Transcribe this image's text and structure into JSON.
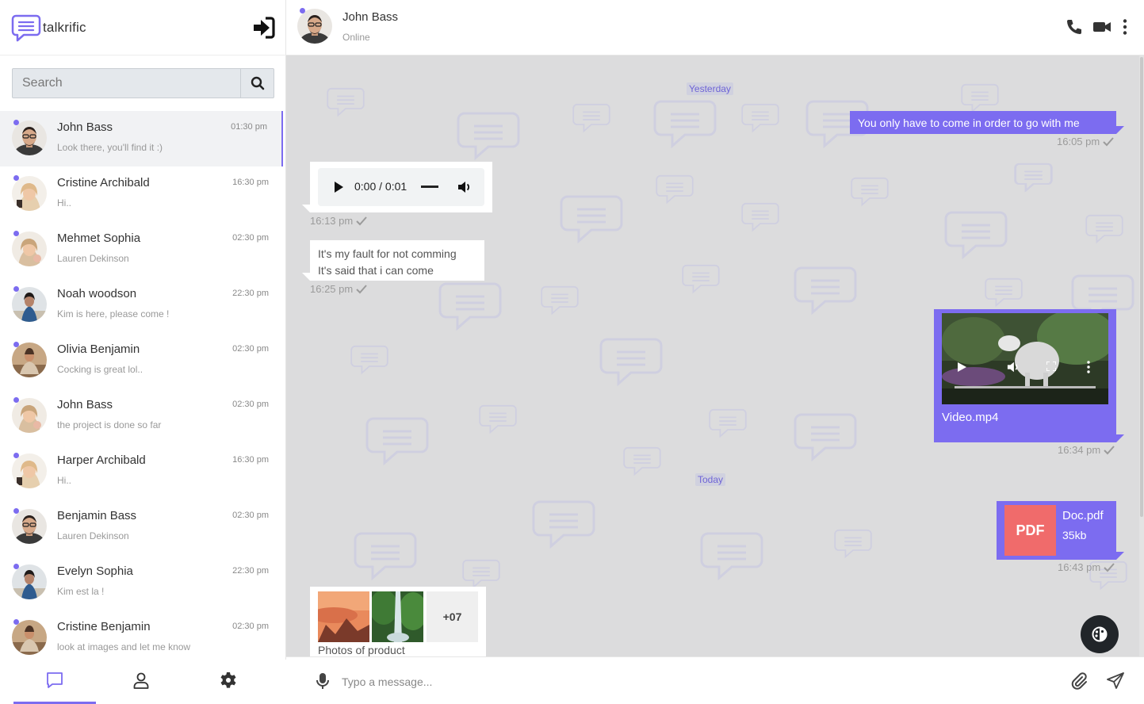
{
  "app": {
    "name": "talkrific"
  },
  "search": {
    "placeholder": "Search"
  },
  "contacts": [
    {
      "name": "John Bass",
      "preview": "Look there, you'll find it :)",
      "time": "01:30 pm",
      "avatar": "man-glasses"
    },
    {
      "name": "Cristine Archibald",
      "preview": "Hi..",
      "time": "16:30 pm",
      "avatar": "woman-blonde"
    },
    {
      "name": "Mehmet Sophia",
      "preview": "Lauren Dekinson",
      "time": "02:30 pm",
      "avatar": "woman-blonde"
    },
    {
      "name": "Noah woodson",
      "preview": "Kim is here, please come !",
      "time": "22:30 pm",
      "avatar": "woman-dark"
    },
    {
      "name": "Olivia Benjamin",
      "preview": "Cocking is great lol..",
      "time": "02:30 pm",
      "avatar": "man-sitting"
    },
    {
      "name": "John Bass",
      "preview": "the project is done so far",
      "time": "02:30 pm",
      "avatar": "woman-blonde"
    },
    {
      "name": "Harper Archibald",
      "preview": "Hi..",
      "time": "16:30 pm",
      "avatar": "woman-blonde"
    },
    {
      "name": "Benjamin Bass",
      "preview": "Lauren Dekinson",
      "time": "02:30 pm",
      "avatar": "man-glasses"
    },
    {
      "name": "Evelyn Sophia",
      "preview": "Kim est la !",
      "time": "22:30 pm",
      "avatar": "woman-dark"
    },
    {
      "name": "Cristine Benjamin",
      "preview": "look at images and let me know",
      "time": "02:30 pm",
      "avatar": "man-sitting"
    }
  ],
  "chat": {
    "name": "John Bass",
    "status": "Online",
    "day_labels": {
      "yesterday": "Yesterday",
      "today": "Today"
    },
    "messages": {
      "m1": {
        "text": "You only have to come in order to go with me",
        "time": "16:05 pm"
      },
      "audio": {
        "time_display": "0:00 / 0:01",
        "time": "16:13 pm"
      },
      "m3": {
        "line1": "It's my fault for not comming",
        "line2": "It's said that i can come",
        "time": "16:25 pm"
      },
      "video": {
        "filename": "Video.mp4",
        "time": "16:34 pm"
      },
      "pdf": {
        "badge": "PDF",
        "filename": "Doc.pdf",
        "size": "35kb",
        "time": "16:43 pm"
      },
      "photos": {
        "more": "+07",
        "caption": "Photos of product"
      }
    }
  },
  "composer": {
    "placeholder": "Typo a message..."
  },
  "colors": {
    "accent": "#7c6cf0",
    "pdf": "#f06b6b",
    "chat_bg": "#dcdcdd"
  },
  "icons": [
    "chat-bubble-icon",
    "logout-icon",
    "search-icon",
    "phone-icon",
    "video-camera-icon",
    "more-vertical-icon",
    "play-icon",
    "volume-icon",
    "fullscreen-icon",
    "check-icon",
    "theme-icon",
    "microphone-icon",
    "paperclip-icon",
    "send-icon",
    "user-icon",
    "gear-icon"
  ]
}
